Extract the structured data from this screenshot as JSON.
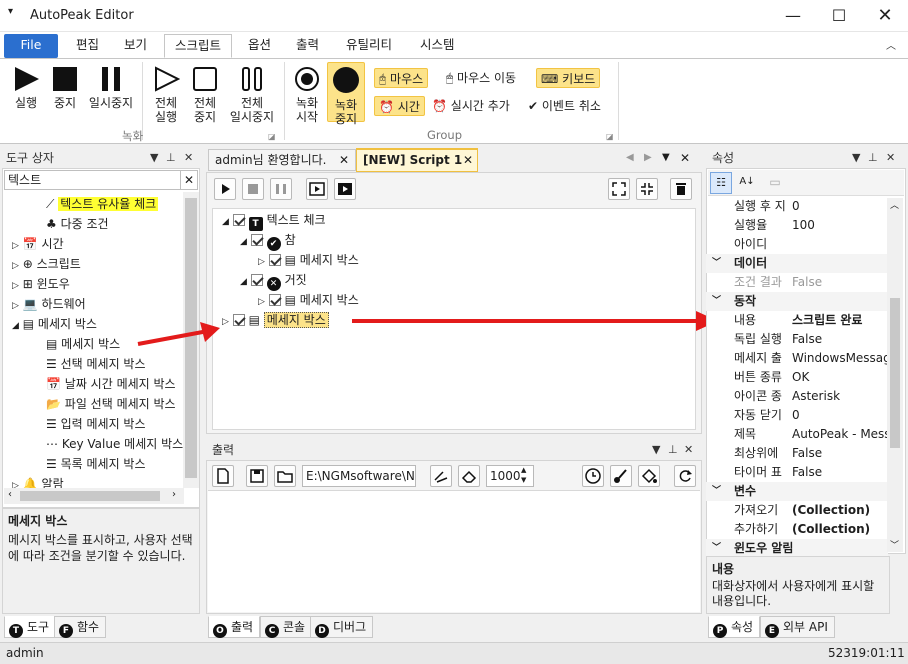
{
  "app": {
    "title": "AutoPeak Editor"
  },
  "ribbon_tabs": [
    "File",
    "편집",
    "보기",
    "스크립트",
    "옵션",
    "출력",
    "유틸리티",
    "시스템"
  ],
  "ribbon": {
    "rec_group": {
      "run": "실행",
      "stop": "중지",
      "pause": "일시중지",
      "run_all_1": "전체",
      "run_all_2": "실행",
      "stop_all_1": "전체",
      "stop_all_2": "중지",
      "pause_all_1": "전체",
      "pause_all_2": "일시중지",
      "label": "녹화"
    },
    "group2": {
      "record_start_1": "녹화",
      "record_start_2": "시작",
      "record_stop_1": "녹화",
      "record_stop_2": "중지",
      "mouse": "마우스",
      "mouse_move": "마우스 이동",
      "keyboard": "키보드",
      "time": "시간",
      "add_realtime": "실시간 추가",
      "cancel_event": "이벤트 취소",
      "label": "Group"
    }
  },
  "toolbox": {
    "title": "도구 상자",
    "search_value": "텍스트",
    "items": [
      "텍스트 유사율 체크",
      "다중 조건",
      "시간",
      "스크립트",
      "윈도우",
      "하드웨어",
      "메세지 박스",
      "메세지 박스",
      "선택 메세지 박스",
      "날짜 시간 메세지 박스",
      "파일 선택 메세지 박스",
      "입력 메세지 박스",
      "Key Value 메세지 박스",
      "목록 메세지 박스",
      "알람"
    ],
    "desc_title": "메세지 박스",
    "desc_text": "메시지 박스를 표시하고, 사용자 선택에 따라 조건을 분기할 수 있습니다.",
    "tabs": [
      "도구",
      "함수"
    ]
  },
  "editor": {
    "tabs": [
      "admin님 환영합니다.",
      "[NEW] Script 1"
    ],
    "tree": [
      "텍스트 체크",
      "참",
      "메세지 박스",
      "거짓",
      "메세지 박스",
      "메세지 박스"
    ]
  },
  "output": {
    "title": "출력",
    "path_value": "E:\\NGMsoftware\\NG",
    "count_value": "1000",
    "tabs": [
      "출력",
      "콘솔",
      "디버그"
    ]
  },
  "properties": {
    "title": "속성",
    "rows": [
      {
        "k": "실행 후 지",
        "v": "0"
      },
      {
        "k": "실행율",
        "v": "100"
      },
      {
        "k": "아이디",
        "v": ""
      },
      {
        "cat": "데이터"
      },
      {
        "k": "조건 결과",
        "v": "False",
        "dim": true
      },
      {
        "cat": "동작"
      },
      {
        "k": "내용",
        "v": "스크립트 완료",
        "bold": true
      },
      {
        "k": "독립 실행",
        "v": "False"
      },
      {
        "k": "메세지 출",
        "v": "WindowsMessage"
      },
      {
        "k": "버튼 종류",
        "v": "OK"
      },
      {
        "k": "아이콘 종",
        "v": "Asterisk"
      },
      {
        "k": "자동 닫기",
        "v": "0"
      },
      {
        "k": "제목",
        "v": "AutoPeak - Messa"
      },
      {
        "k": "최상위에",
        "v": "False"
      },
      {
        "k": "타이머 표",
        "v": "False"
      },
      {
        "cat": "변수"
      },
      {
        "k": "가져오기",
        "v": "(Collection)",
        "bold": true
      },
      {
        "k": "추가하기",
        "v": "(Collection)",
        "bold": true
      },
      {
        "cat": "윈도우 알림"
      }
    ],
    "desc_title": "내용",
    "desc_text": "대화상자에서 사용자에게 표시할 내용입니다.",
    "tabs": [
      "속성",
      "외부 API"
    ]
  },
  "status": {
    "user": "admin",
    "time": "52319:01:11"
  }
}
